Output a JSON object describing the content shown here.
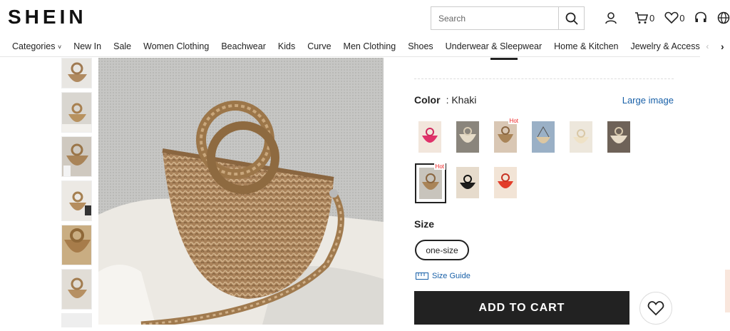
{
  "header": {
    "logo": "SHEIN",
    "search_placeholder": "Search",
    "cart_count": "0",
    "wishlist_count": "0",
    "icons": [
      "search-icon",
      "user-icon",
      "cart-icon",
      "heart-icon",
      "headset-icon",
      "globe-icon"
    ]
  },
  "nav": {
    "items": [
      "Categories",
      "New In",
      "Sale",
      "Women Clothing",
      "Beachwear",
      "Kids",
      "Curve",
      "Men Clothing",
      "Shoes",
      "Underwear & Sleepwear",
      "Home & Kitchen",
      "Jewelry & Accessories"
    ]
  },
  "product": {
    "color_label": "Color",
    "color_value": ": Khaki",
    "large_image_link": "Large image",
    "hot_label": "Hot",
    "size_title": "Size",
    "size_option": "one-size",
    "size_guide": "Size Guide",
    "add_to_cart": "ADD TO CART",
    "accent_color": "#e22222",
    "link_color": "#1860a8"
  }
}
